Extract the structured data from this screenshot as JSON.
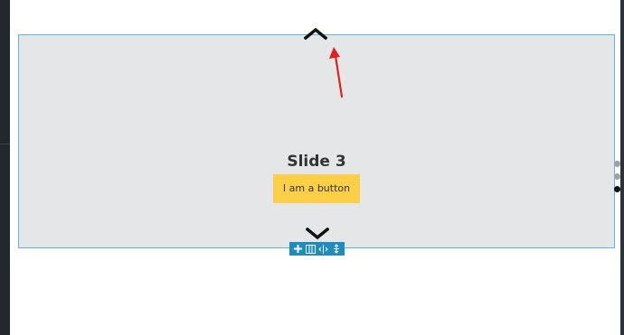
{
  "slide": {
    "title": "Slide 3",
    "button_label": "I am a button"
  },
  "pagination": {
    "total": 3,
    "active_index": 2
  },
  "navigation": {
    "prev_icon": "chevron-up-icon",
    "next_icon": "chevron-down-icon"
  },
  "toolbar": {
    "tools": [
      "add-icon",
      "columns-icon",
      "horizontal-resize-icon",
      "vertical-resize-icon"
    ]
  },
  "colors": {
    "slider_background": "#e5e6e8",
    "slider_border": "#60b3e5",
    "button_background": "#fccf47",
    "toolbar_background": "#1e8cbe",
    "annotation_arrow": "#e02020",
    "dot_inactive": "#a0a0a0",
    "dot_active": "#111111"
  }
}
